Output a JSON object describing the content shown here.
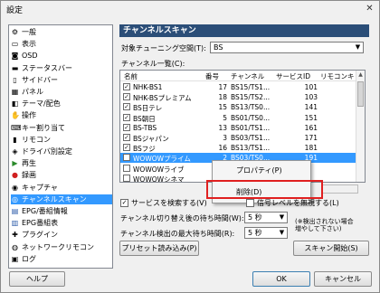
{
  "window": {
    "title": "設定"
  },
  "sidebar": {
    "items": [
      {
        "label": "一般",
        "icon": "settings-icon"
      },
      {
        "label": "表示",
        "icon": "display-icon"
      },
      {
        "label": "OSD",
        "icon": "osd-icon"
      },
      {
        "label": "ステータスバー",
        "icon": "statusbar-icon"
      },
      {
        "label": "サイドバー",
        "icon": "sidebar-icon"
      },
      {
        "label": "パネル",
        "icon": "panel-icon"
      },
      {
        "label": "テーマ/配色",
        "icon": "theme-icon"
      },
      {
        "label": "操作",
        "icon": "operation-icon"
      },
      {
        "label": "キー割り当て",
        "icon": "key-icon"
      },
      {
        "label": "リモコン",
        "icon": "remote-icon"
      },
      {
        "label": "ドライバ別設定",
        "icon": "driver-icon"
      },
      {
        "label": "再生",
        "icon": "play-icon"
      },
      {
        "label": "録画",
        "icon": "record-icon"
      },
      {
        "label": "キャプチャ",
        "icon": "capture-icon"
      },
      {
        "label": "チャンネルスキャン",
        "icon": "channel-scan-icon",
        "selected": true
      },
      {
        "label": "EPG/番組情報",
        "icon": "epg-icon"
      },
      {
        "label": "EPG番組表",
        "icon": "epg-table-icon"
      },
      {
        "label": "プラグイン",
        "icon": "plugin-icon"
      },
      {
        "label": "ネットワークリモコン",
        "icon": "network-remote-icon"
      },
      {
        "label": "ログ",
        "icon": "log-icon"
      }
    ]
  },
  "panel": {
    "header": "チャンネルスキャン",
    "tuning_space_label": "対象チューニング空間(T):",
    "tuning_space_value": "BS",
    "channel_list_label": "チャンネル一覧(C):",
    "columns": [
      "名前",
      "番号",
      "チャンネル",
      "サービスID",
      "リモコンキ"
    ],
    "rows": [
      {
        "checked": true,
        "name": "NHK-BS1",
        "num": "17",
        "ch": "BS15/TS1...",
        "sid": "101"
      },
      {
        "checked": true,
        "name": "NHK-BSプレミアム",
        "num": "18",
        "ch": "BS15/TS2...",
        "sid": "103"
      },
      {
        "checked": true,
        "name": "BS日テレ",
        "num": "15",
        "ch": "BS13/TS0...",
        "sid": "141"
      },
      {
        "checked": true,
        "name": "BS朝日",
        "num": "5",
        "ch": "BS01/TS0...",
        "sid": "151"
      },
      {
        "checked": true,
        "name": "BS-TBS",
        "num": "13",
        "ch": "BS01/TS1...",
        "sid": "161"
      },
      {
        "checked": true,
        "name": "BSジャパン",
        "num": "3",
        "ch": "BS03/TS1...",
        "sid": "171"
      },
      {
        "checked": true,
        "name": "BSフジ",
        "num": "16",
        "ch": "BS13/TS1...",
        "sid": "181"
      },
      {
        "checked": false,
        "name": "WOWOWプライム",
        "num": "2",
        "ch": "BS03/TS0...",
        "sid": "191",
        "selected": true
      },
      {
        "checked": false,
        "name": "WOWOWライブ",
        "num": "",
        "ch": "",
        "sid": ""
      },
      {
        "checked": false,
        "name": "WOWOWシネマ",
        "num": "",
        "ch": "",
        "sid": ""
      }
    ],
    "context_menu": {
      "properties": "プロパティ(P)",
      "delete": "削除(D)"
    },
    "search_services": "サービスを検索する(V)",
    "ignore_signal": "信号レベルを無視する(L)",
    "switch_wait_label": "チャンネル切り替え後の待ち時間(W):",
    "switch_wait_value": "5 秒",
    "max_wait_label": "チャンネル検出の最大待ち時間(R):",
    "max_wait_value": "5 秒",
    "note": "(※検出されない場合\n増やして下さい)",
    "preset_button": "プリセット読み込み(P)",
    "scan_button": "スキャン開始(S)"
  },
  "footer": {
    "help": "ヘルプ",
    "ok": "OK",
    "cancel": "キャンセル"
  },
  "colors": {
    "selection": "#3399ff",
    "header": "#2b4e78",
    "highlight_box": "#e02020"
  }
}
